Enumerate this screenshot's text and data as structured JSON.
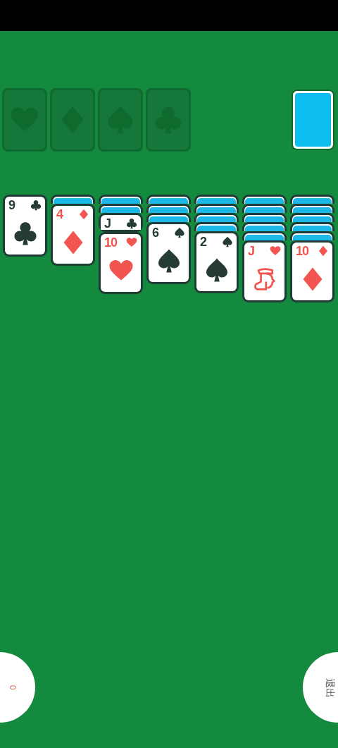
{
  "foundations": [
    {
      "kind": "heart"
    },
    {
      "kind": "diamond"
    },
    {
      "kind": "spade"
    },
    {
      "kind": "club"
    }
  ],
  "stock": {
    "kind": "back"
  },
  "tableau": [
    {
      "cards": [
        {
          "face_up": true,
          "rank": "9",
          "kind": "club"
        }
      ]
    },
    {
      "cards": [
        {
          "face_up": false
        },
        {
          "face_up": true,
          "rank": "4",
          "kind": "diamond"
        }
      ]
    },
    {
      "cards": [
        {
          "face_up": false
        },
        {
          "face_up": false
        },
        {
          "face_up": true,
          "rank": "J",
          "kind": "club"
        },
        {
          "face_up": true,
          "rank": "10",
          "kind": "heart"
        }
      ]
    },
    {
      "cards": [
        {
          "face_up": false
        },
        {
          "face_up": false
        },
        {
          "face_up": false
        },
        {
          "face_up": true,
          "rank": "6",
          "kind": "spade"
        }
      ]
    },
    {
      "cards": [
        {
          "face_up": false
        },
        {
          "face_up": false
        },
        {
          "face_up": false
        },
        {
          "face_up": false
        },
        {
          "face_up": true,
          "rank": "2",
          "kind": "spade"
        }
      ]
    },
    {
      "cards": [
        {
          "face_up": false
        },
        {
          "face_up": false
        },
        {
          "face_up": false
        },
        {
          "face_up": false
        },
        {
          "face_up": false
        },
        {
          "face_up": true,
          "rank": "J",
          "kind": "heart",
          "figure": true
        }
      ]
    },
    {
      "cards": [
        {
          "face_up": false
        },
        {
          "face_up": false
        },
        {
          "face_up": false
        },
        {
          "face_up": false
        },
        {
          "face_up": false
        },
        {
          "face_up": true,
          "rank": "10",
          "kind": "diamond"
        }
      ]
    }
  ],
  "left_button": {
    "label": "0"
  },
  "right_button": {
    "label": "退出"
  }
}
